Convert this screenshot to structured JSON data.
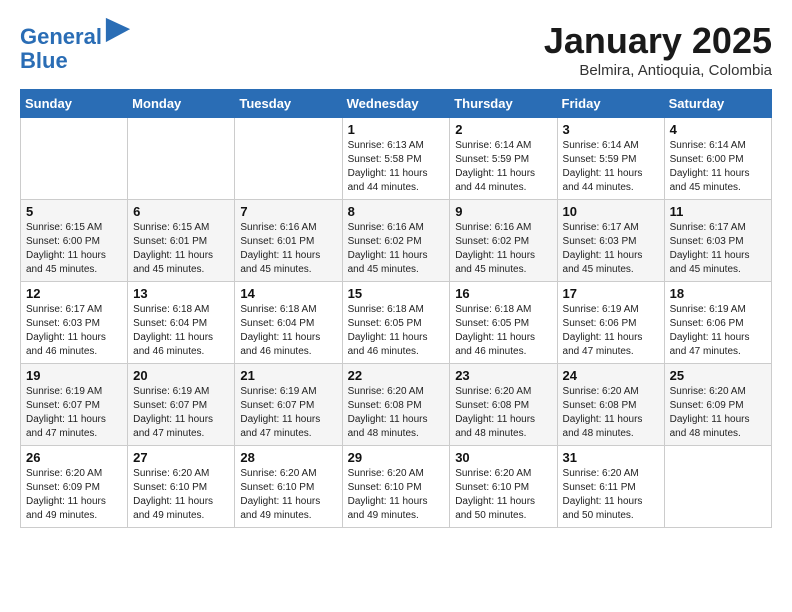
{
  "logo": {
    "line1": "General",
    "line2": "Blue"
  },
  "title": "January 2025",
  "location": "Belmira, Antioquia, Colombia",
  "weekdays": [
    "Sunday",
    "Monday",
    "Tuesday",
    "Wednesday",
    "Thursday",
    "Friday",
    "Saturday"
  ],
  "weeks": [
    [
      {
        "day": "",
        "info": ""
      },
      {
        "day": "",
        "info": ""
      },
      {
        "day": "",
        "info": ""
      },
      {
        "day": "1",
        "info": "Sunrise: 6:13 AM\nSunset: 5:58 PM\nDaylight: 11 hours\nand 44 minutes."
      },
      {
        "day": "2",
        "info": "Sunrise: 6:14 AM\nSunset: 5:59 PM\nDaylight: 11 hours\nand 44 minutes."
      },
      {
        "day": "3",
        "info": "Sunrise: 6:14 AM\nSunset: 5:59 PM\nDaylight: 11 hours\nand 44 minutes."
      },
      {
        "day": "4",
        "info": "Sunrise: 6:14 AM\nSunset: 6:00 PM\nDaylight: 11 hours\nand 45 minutes."
      }
    ],
    [
      {
        "day": "5",
        "info": "Sunrise: 6:15 AM\nSunset: 6:00 PM\nDaylight: 11 hours\nand 45 minutes."
      },
      {
        "day": "6",
        "info": "Sunrise: 6:15 AM\nSunset: 6:01 PM\nDaylight: 11 hours\nand 45 minutes."
      },
      {
        "day": "7",
        "info": "Sunrise: 6:16 AM\nSunset: 6:01 PM\nDaylight: 11 hours\nand 45 minutes."
      },
      {
        "day": "8",
        "info": "Sunrise: 6:16 AM\nSunset: 6:02 PM\nDaylight: 11 hours\nand 45 minutes."
      },
      {
        "day": "9",
        "info": "Sunrise: 6:16 AM\nSunset: 6:02 PM\nDaylight: 11 hours\nand 45 minutes."
      },
      {
        "day": "10",
        "info": "Sunrise: 6:17 AM\nSunset: 6:03 PM\nDaylight: 11 hours\nand 45 minutes."
      },
      {
        "day": "11",
        "info": "Sunrise: 6:17 AM\nSunset: 6:03 PM\nDaylight: 11 hours\nand 45 minutes."
      }
    ],
    [
      {
        "day": "12",
        "info": "Sunrise: 6:17 AM\nSunset: 6:03 PM\nDaylight: 11 hours\nand 46 minutes."
      },
      {
        "day": "13",
        "info": "Sunrise: 6:18 AM\nSunset: 6:04 PM\nDaylight: 11 hours\nand 46 minutes."
      },
      {
        "day": "14",
        "info": "Sunrise: 6:18 AM\nSunset: 6:04 PM\nDaylight: 11 hours\nand 46 minutes."
      },
      {
        "day": "15",
        "info": "Sunrise: 6:18 AM\nSunset: 6:05 PM\nDaylight: 11 hours\nand 46 minutes."
      },
      {
        "day": "16",
        "info": "Sunrise: 6:18 AM\nSunset: 6:05 PM\nDaylight: 11 hours\nand 46 minutes."
      },
      {
        "day": "17",
        "info": "Sunrise: 6:19 AM\nSunset: 6:06 PM\nDaylight: 11 hours\nand 47 minutes."
      },
      {
        "day": "18",
        "info": "Sunrise: 6:19 AM\nSunset: 6:06 PM\nDaylight: 11 hours\nand 47 minutes."
      }
    ],
    [
      {
        "day": "19",
        "info": "Sunrise: 6:19 AM\nSunset: 6:07 PM\nDaylight: 11 hours\nand 47 minutes."
      },
      {
        "day": "20",
        "info": "Sunrise: 6:19 AM\nSunset: 6:07 PM\nDaylight: 11 hours\nand 47 minutes."
      },
      {
        "day": "21",
        "info": "Sunrise: 6:19 AM\nSunset: 6:07 PM\nDaylight: 11 hours\nand 47 minutes."
      },
      {
        "day": "22",
        "info": "Sunrise: 6:20 AM\nSunset: 6:08 PM\nDaylight: 11 hours\nand 48 minutes."
      },
      {
        "day": "23",
        "info": "Sunrise: 6:20 AM\nSunset: 6:08 PM\nDaylight: 11 hours\nand 48 minutes."
      },
      {
        "day": "24",
        "info": "Sunrise: 6:20 AM\nSunset: 6:08 PM\nDaylight: 11 hours\nand 48 minutes."
      },
      {
        "day": "25",
        "info": "Sunrise: 6:20 AM\nSunset: 6:09 PM\nDaylight: 11 hours\nand 48 minutes."
      }
    ],
    [
      {
        "day": "26",
        "info": "Sunrise: 6:20 AM\nSunset: 6:09 PM\nDaylight: 11 hours\nand 49 minutes."
      },
      {
        "day": "27",
        "info": "Sunrise: 6:20 AM\nSunset: 6:10 PM\nDaylight: 11 hours\nand 49 minutes."
      },
      {
        "day": "28",
        "info": "Sunrise: 6:20 AM\nSunset: 6:10 PM\nDaylight: 11 hours\nand 49 minutes."
      },
      {
        "day": "29",
        "info": "Sunrise: 6:20 AM\nSunset: 6:10 PM\nDaylight: 11 hours\nand 49 minutes."
      },
      {
        "day": "30",
        "info": "Sunrise: 6:20 AM\nSunset: 6:10 PM\nDaylight: 11 hours\nand 50 minutes."
      },
      {
        "day": "31",
        "info": "Sunrise: 6:20 AM\nSunset: 6:11 PM\nDaylight: 11 hours\nand 50 minutes."
      },
      {
        "day": "",
        "info": ""
      }
    ]
  ]
}
